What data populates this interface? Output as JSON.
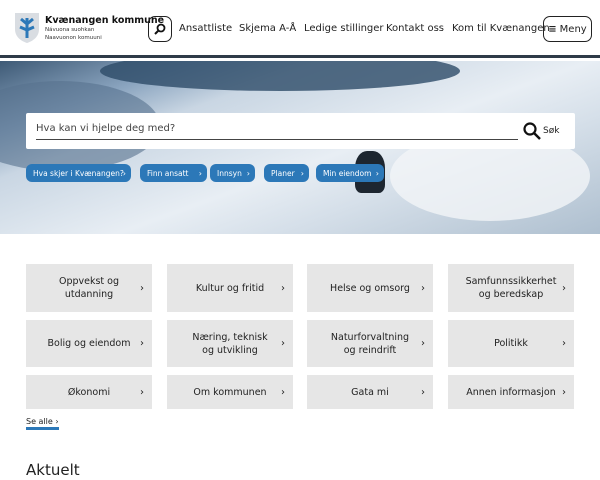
{
  "header": {
    "title": "Kvænangen kommune",
    "subtitle1": "Návuona suohkan",
    "subtitle2": "Naavuonon komuuni",
    "nav": [
      "Ansattliste",
      "Skjema A-Å",
      "Ledige stillinger",
      "Kontakt oss",
      "Kom til Kvænangen"
    ],
    "menu_label": "Meny",
    "menu_icon": "≡"
  },
  "search": {
    "placeholder": "Hva kan vi hjelpe deg med?",
    "button_label": "Søk"
  },
  "quick_links": [
    "Hva skjer i Kvænangen?",
    "Finn ansatt",
    "Innsyn",
    "Planer",
    "Min eiendom"
  ],
  "tiles": [
    "Oppvekst og utdanning",
    "Kultur og fritid",
    "Helse og omsorg",
    "Samfunnssikkerhet og beredskap",
    "Bolig og eiendom",
    "Næring, teknisk og utvikling",
    "Naturforvaltning og reindrift",
    "Politikk",
    "Økonomi",
    "Om kommunen",
    "Gata mi",
    "Annen informasjon"
  ],
  "see_all": "Se alle ›",
  "news_heading": "Aktuelt",
  "chevron": "›",
  "accent": "#2c78b8"
}
